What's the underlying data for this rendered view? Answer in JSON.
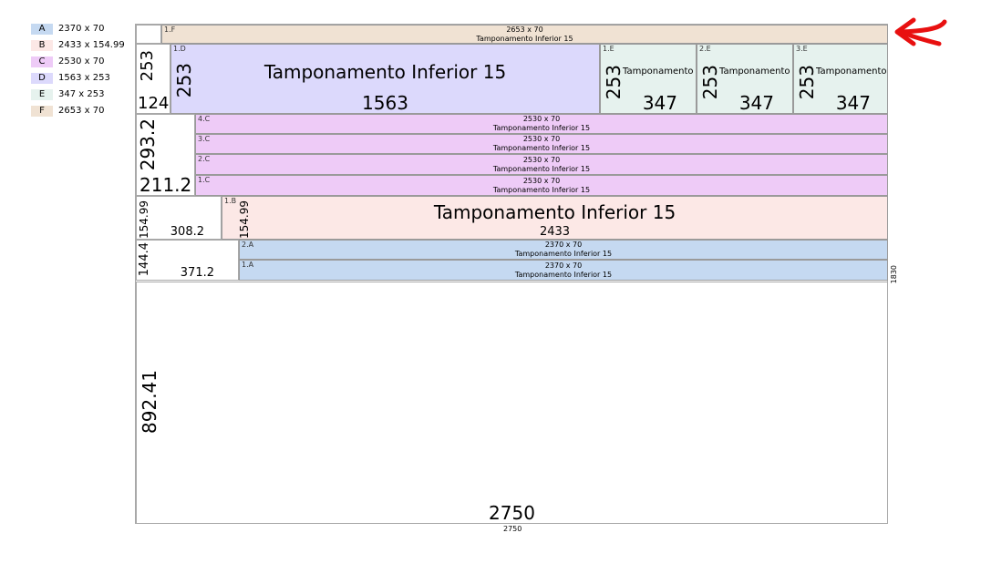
{
  "legend": [
    {
      "key": "A",
      "label": "2370 x 70",
      "color": "#c5d9f1"
    },
    {
      "key": "B",
      "label": "2433 x 154.99",
      "color": "#fce8e6"
    },
    {
      "key": "C",
      "label": "2530 x 70",
      "color": "#eecbf7"
    },
    {
      "key": "D",
      "label": "1563 x 253",
      "color": "#dcd9fc"
    },
    {
      "key": "E",
      "label": "347 x 253",
      "color": "#e6f2ee"
    },
    {
      "key": "F",
      "label": "2653 x 70",
      "color": "#f0e2d3"
    }
  ],
  "pieces": {
    "f1": {
      "id": "1.F",
      "dims": "2653 x 70",
      "name": "Tamponamento Inferior 15"
    },
    "d1": {
      "id": "1.D",
      "name": "Tamponamento Inferior 15",
      "width": "1563",
      "height": "253"
    },
    "e1": {
      "id": "1.E",
      "name": "Tamponamento",
      "width": "347",
      "height": "253"
    },
    "e2": {
      "id": "2.E",
      "name": "Tamponamento",
      "width": "347",
      "height": "253"
    },
    "e3": {
      "id": "3.E",
      "name": "Tamponamento",
      "width": "347",
      "height": "253"
    },
    "c4": {
      "id": "4.C",
      "dims": "2530 x 70",
      "name": "Tamponamento Inferior 15"
    },
    "c3": {
      "id": "3.C",
      "dims": "2530 x 70",
      "name": "Tamponamento Inferior 15"
    },
    "c2": {
      "id": "2.C",
      "dims": "2530 x 70",
      "name": "Tamponamento Inferior 15"
    },
    "c1": {
      "id": "1.C",
      "dims": "2530 x 70",
      "name": "Tamponamento Inferior 15"
    },
    "b1": {
      "id": "1.B",
      "name": "Tamponamento Inferior 15",
      "width": "2433",
      "height": "154.99"
    },
    "a2": {
      "id": "2.A",
      "dims": "2370 x 70",
      "name": "Tamponamento Inferior 15"
    },
    "a1": {
      "id": "1.A",
      "dims": "2370 x 70",
      "name": "Tamponamento Inferior 15"
    }
  },
  "waste": {
    "w_d": {
      "width": "124",
      "height": "253"
    },
    "w_c": {
      "width": "211.2",
      "height": "293.2"
    },
    "w_b": {
      "width": "308.2",
      "height": "154.99"
    },
    "w_a": {
      "width": "371.2",
      "height": "144.4"
    },
    "w_bottom": {
      "width": "2750",
      "height": "892.41"
    }
  },
  "sheet": {
    "width": "2750",
    "height": "1830"
  }
}
